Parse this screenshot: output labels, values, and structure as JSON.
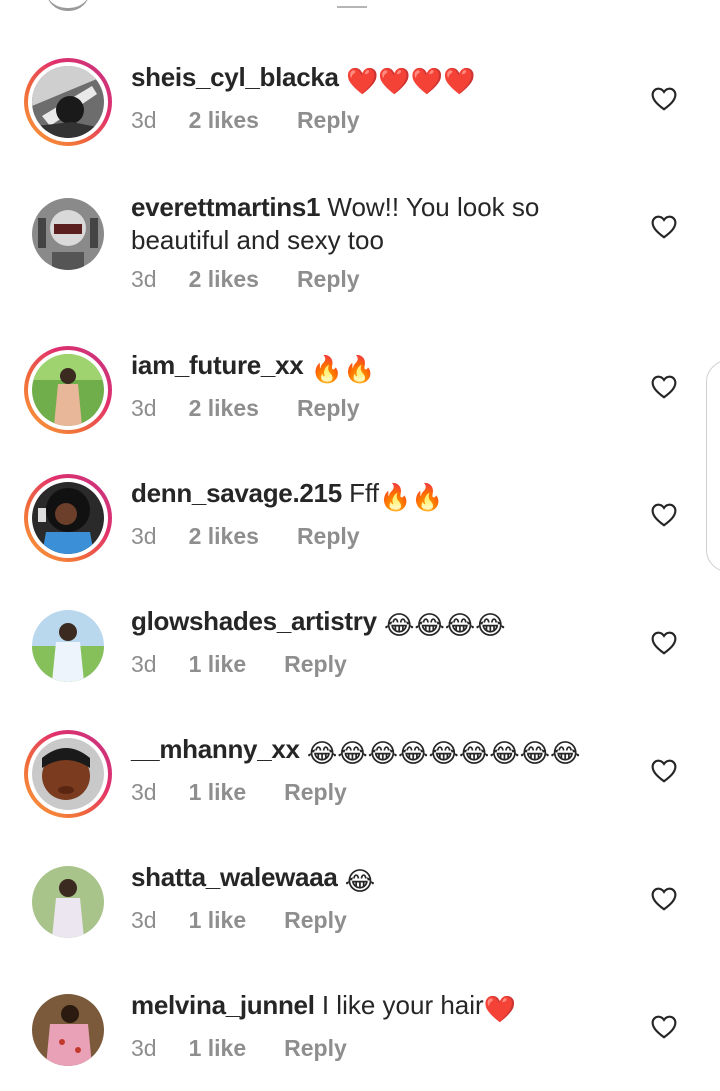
{
  "colors": {
    "story_ring_start": "#f9a13b",
    "story_ring_end": "#c13584",
    "meta_text": "#8e8e8e",
    "text": "#262626",
    "heart_red": "#d31d2f"
  },
  "comments": [
    {
      "username": "sheis_cyl_blacka",
      "text": "",
      "emoji": "❤️❤️❤️❤️",
      "time": "3d",
      "likes": "2 likes",
      "reply": "Reply",
      "story": true
    },
    {
      "username": "everettmartins1",
      "text": " Wow!! You look so beautiful and sexy too",
      "emoji": "",
      "time": "3d",
      "likes": "2 likes",
      "reply": "Reply",
      "story": false
    },
    {
      "username": "iam_future_xx",
      "text": "",
      "emoji": "🔥🔥",
      "time": "3d",
      "likes": "2 likes",
      "reply": "Reply",
      "story": true
    },
    {
      "username": "denn_savage.215",
      "text": " Fff",
      "emoji": "🔥🔥",
      "time": "3d",
      "likes": "2 likes",
      "reply": "Reply",
      "story": true
    },
    {
      "username": "glowshades_artistry",
      "text": "",
      "emoji": "😂😂😂😂",
      "time": "3d",
      "likes": "1 like",
      "reply": "Reply",
      "story": false
    },
    {
      "username": "__mhanny_xx",
      "text": "",
      "emoji": "😂😂😂😂😂😂😂😂😂",
      "time": "3d",
      "likes": "1 like",
      "reply": "Reply",
      "story": true
    },
    {
      "username": "shatta_walewaaa",
      "text": "",
      "emoji": "😂",
      "time": "3d",
      "likes": "1 like",
      "reply": "Reply",
      "story": false
    },
    {
      "username": "melvina_junnel",
      "text": " I like your hair",
      "emoji": "❤️",
      "time": "3d",
      "likes": "1 like",
      "reply": "Reply",
      "story": false
    }
  ],
  "icons": {
    "like": "heart-outline-icon",
    "emoji_heart": "red-heart-emoji",
    "emoji_fire": "fire-emoji",
    "emoji_laugh": "tears-of-joy-emoji"
  }
}
